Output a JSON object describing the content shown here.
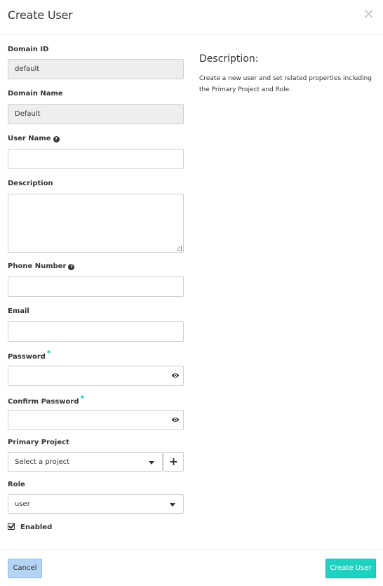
{
  "header": {
    "title": "Create User",
    "close_icon": "close-icon"
  },
  "form": {
    "domain_id": {
      "label": "Domain ID",
      "value": "default"
    },
    "domain_name": {
      "label": "Domain Name",
      "value": "Default"
    },
    "user_name": {
      "label": "User Name",
      "value": ""
    },
    "description": {
      "label": "Description",
      "value": ""
    },
    "phone_number": {
      "label": "Phone Number",
      "value": ""
    },
    "email": {
      "label": "Email",
      "value": ""
    },
    "password": {
      "label": "Password",
      "required_marker": "*",
      "value": ""
    },
    "confirm_password": {
      "label": "Confirm Password",
      "required_marker": "*",
      "value": ""
    },
    "primary_project": {
      "label": "Primary Project",
      "selected": "Select a project",
      "add_label": "+"
    },
    "role": {
      "label": "Role",
      "selected": "user"
    },
    "enabled": {
      "label": "Enabled",
      "checked": true
    }
  },
  "help": {
    "title": "Description:",
    "text": "Create a new user and set related properties including the Primary Project and Role."
  },
  "footer": {
    "cancel_label": "Cancel",
    "create_label": "Create User"
  },
  "colors": {
    "accent": "#1ed1c1",
    "required": "#1ec7b7",
    "cancel_bg": "#b3d4f5"
  }
}
